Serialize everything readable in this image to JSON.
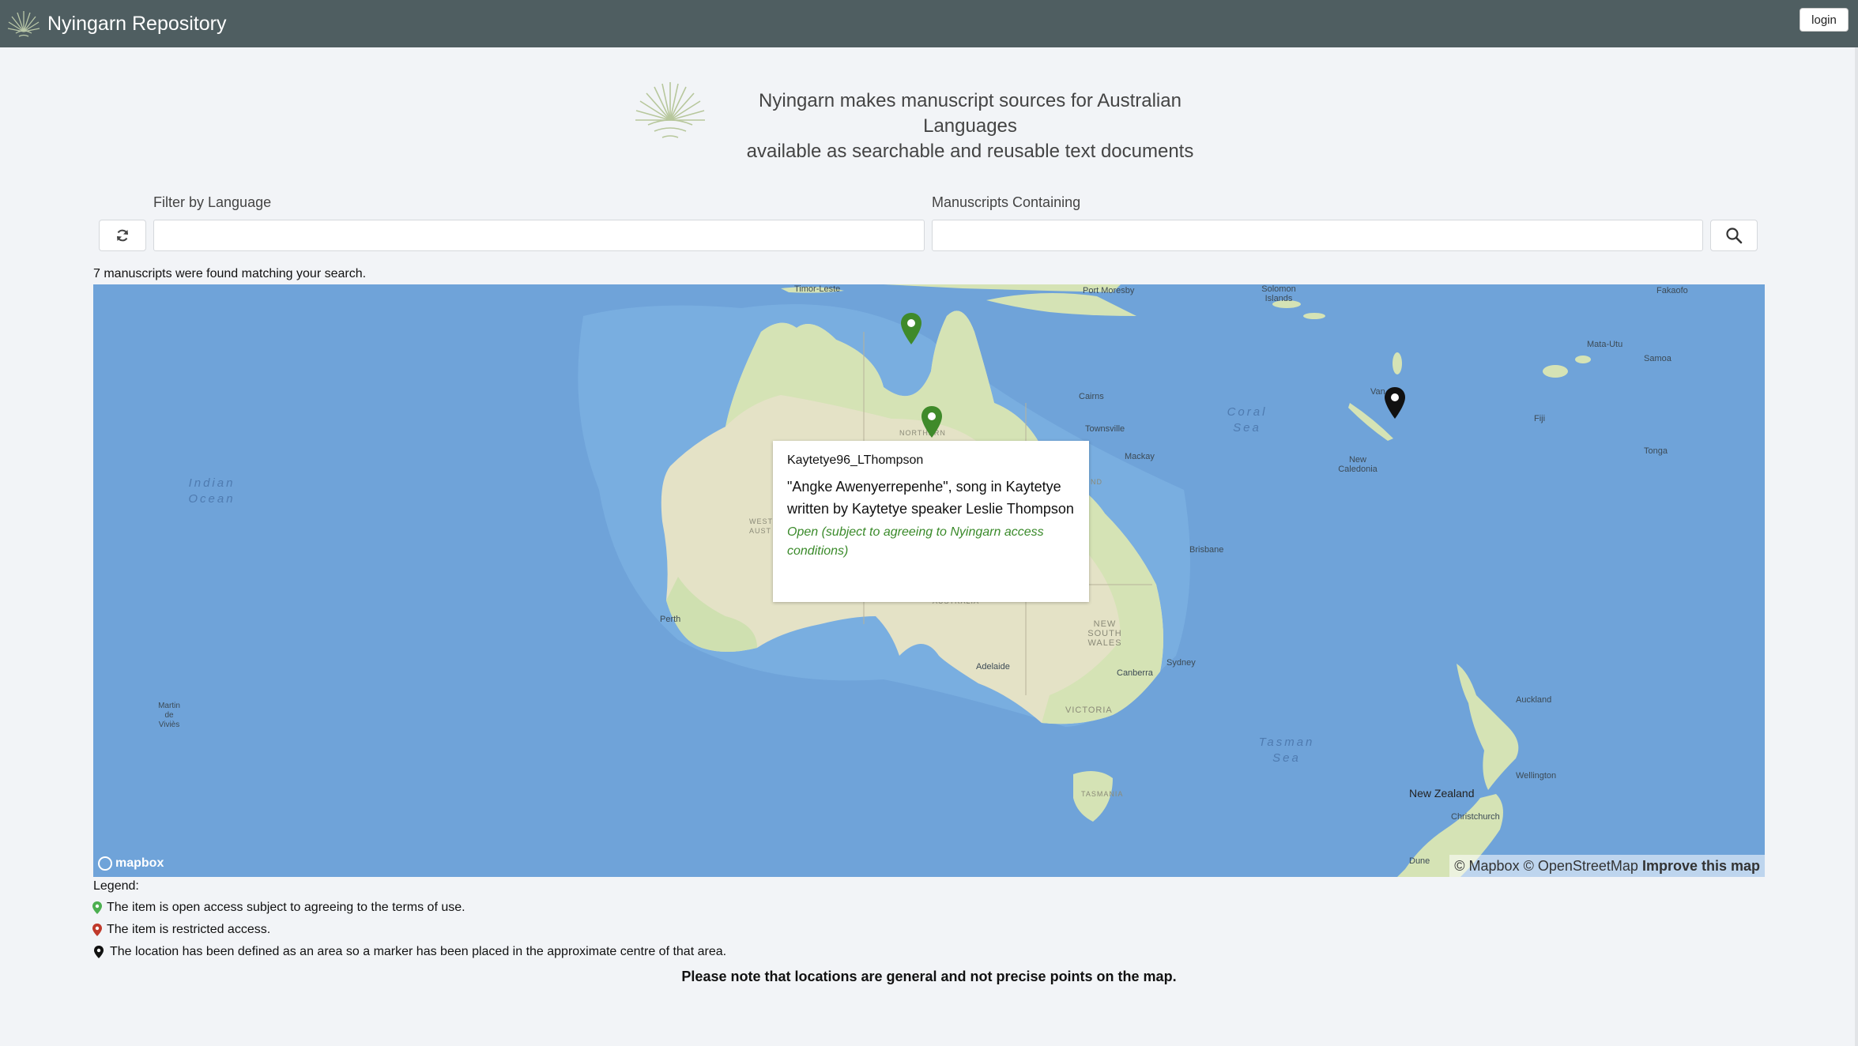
{
  "navbar": {
    "brand": "Nyingarn Repository",
    "login_label": "login"
  },
  "hero": {
    "line1": "Nyingarn makes manuscript sources for Australian Languages",
    "line2": "available as searchable and reusable text documents"
  },
  "filters": {
    "language_label": "Filter by Language",
    "language_value": "",
    "manuscripts_label": "Manuscripts Containing",
    "manuscripts_value": ""
  },
  "results": {
    "count_text": "7 manuscripts were found matching your search."
  },
  "map": {
    "places": {
      "timor_leste": "Timor-Leste",
      "port_moresby": "Port Moresby",
      "solomon_islands": "Solomon Islands",
      "fakaofo": "Fakaofo",
      "mata_utu": "Mata-Utu",
      "samoa": "Samoa",
      "cairns": "Cairns",
      "townsville": "Townsville",
      "mackay": "Mackay",
      "fiji": "Fiji",
      "tonga": "Tonga",
      "new_caledonia": "New Caledonia",
      "vanuatu_short": "Van",
      "brisbane": "Brisbane",
      "perth": "Perth",
      "adelaide": "Adelaide",
      "sydney": "Sydney",
      "canberra": "Canberra",
      "new_south_wales": "NEW SOUTH WALES",
      "victoria": "VICTORIA",
      "tasmania": "TASMANIA",
      "auckland": "Auckland",
      "wellington": "Wellington",
      "new_zealand": "New Zealand",
      "christchurch": "Christchurch",
      "dunedin_short": "Dune",
      "martin_de_vivies": "Martin de Viviès",
      "northern_short": "NORTHERN",
      "west_short": "WEST AUST",
      "qld_short": "ND",
      "australia_short": "AUSTRALIA"
    },
    "seas": {
      "indian_ocean": "Indian Ocean",
      "coral_sea": "Coral Sea",
      "tasman_sea": "Tasman Sea"
    },
    "markers": [
      {
        "name": "marker-north-coast",
        "status": "open",
        "color": "#3f8a2a"
      },
      {
        "name": "marker-kaytetye",
        "status": "open",
        "color": "#3f8a2a"
      },
      {
        "name": "marker-vanuatu-area",
        "status": "area",
        "color": "#111111"
      }
    ],
    "popup": {
      "id": "Kaytetye96_LThompson",
      "description": "\"Angke Awenyerrepenhe\", song in Kaytetye written by Kaytetye speaker Leslie Thompson",
      "access": "Open (subject to agreeing to Nyingarn access conditions)"
    },
    "logo_text": "mapbox",
    "attribution": {
      "mapbox": "© Mapbox",
      "osm": "© OpenStreetMap",
      "improve": "Improve this map"
    }
  },
  "legend": {
    "title": "Legend:",
    "open": "The item is open access subject to agreeing to the terms of use.",
    "restricted": "The item is restricted access.",
    "area": "The location has been defined as an area so a marker has been placed in the approximate centre of that area.",
    "colors": {
      "open": "#4caf50",
      "restricted": "#c0392b",
      "area": "#111111"
    }
  },
  "note": "Please note that locations are general and not precise points on the map."
}
